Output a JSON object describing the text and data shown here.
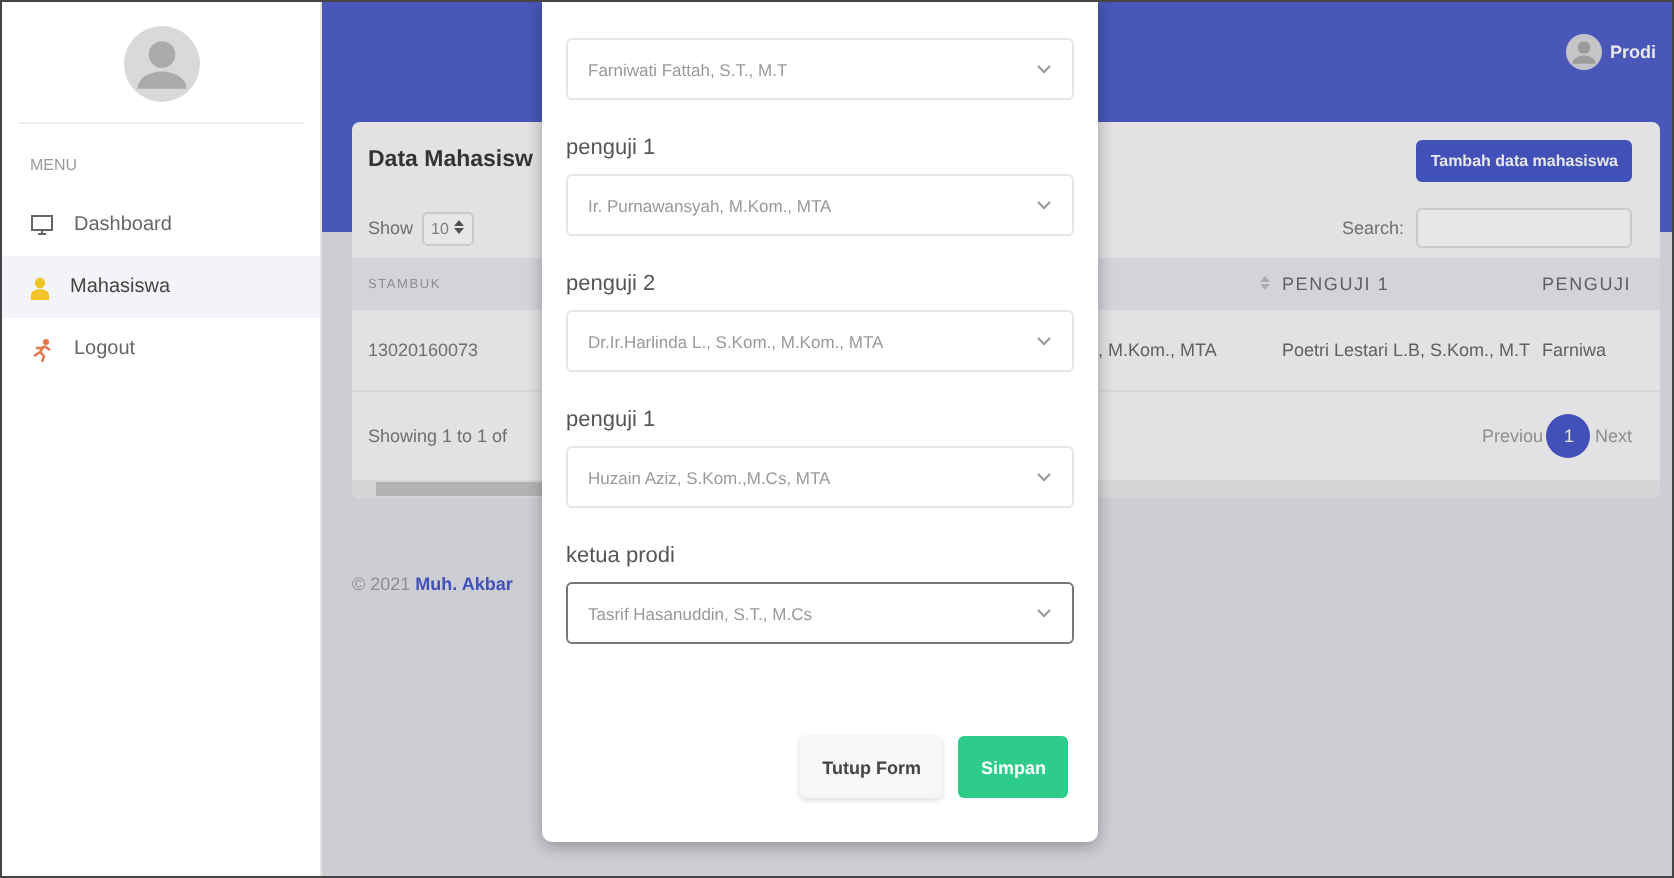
{
  "sidebar": {
    "menu_heading": "MENU",
    "items": [
      {
        "label": "Dashboard",
        "selected": false
      },
      {
        "label": "Mahasiswa",
        "selected": true
      },
      {
        "label": "Logout",
        "selected": false
      }
    ]
  },
  "header": {
    "user": "Prodi"
  },
  "card": {
    "title": "Data Mahasisw",
    "add_button": "Tambah data mahasiswa",
    "show_label": "Show",
    "page_size": "10",
    "search_label": "Search:",
    "columns_left": [
      "STAMBUK"
    ],
    "columns_right": [
      "PENGUJI 1",
      "PENGUJI"
    ],
    "row": {
      "stambuk": "13020160073",
      "cells_right": [
        ", M.Kom., MTA",
        "Poetri Lestari L.B, S.Kom., M.T",
        "Farniwa"
      ]
    },
    "info": "Showing 1 to 1 of",
    "pagination": {
      "previous": "Previou",
      "pages": [
        {
          "label": "1",
          "selected": true
        }
      ],
      "next": "Next"
    }
  },
  "footer": {
    "year": "© 2021",
    "author": "Muh. Akbar"
  },
  "modal": {
    "fields": [
      {
        "value": "Farniwati Fattah, S.T., M.T",
        "focused": false
      },
      {
        "label": "penguji 1",
        "value": "Ir. Purnawansyah, M.Kom., MTA",
        "focused": false
      },
      {
        "label": "penguji 2",
        "value": "Dr.Ir.Harlinda L., S.Kom., M.Kom., MTA",
        "focused": false
      },
      {
        "label": "penguji 1",
        "value": "Huzain Aziz, S.Kom.,M.Cs, MTA",
        "focused": false
      },
      {
        "label": "ketua prodi",
        "value": "Tasrif Hasanuddin, S.T., M.Cs",
        "focused": true
      }
    ],
    "buttons": [
      {
        "label": "Tutup Form",
        "kind": "secondary"
      },
      {
        "label": "Simpan",
        "kind": "primary"
      }
    ]
  }
}
